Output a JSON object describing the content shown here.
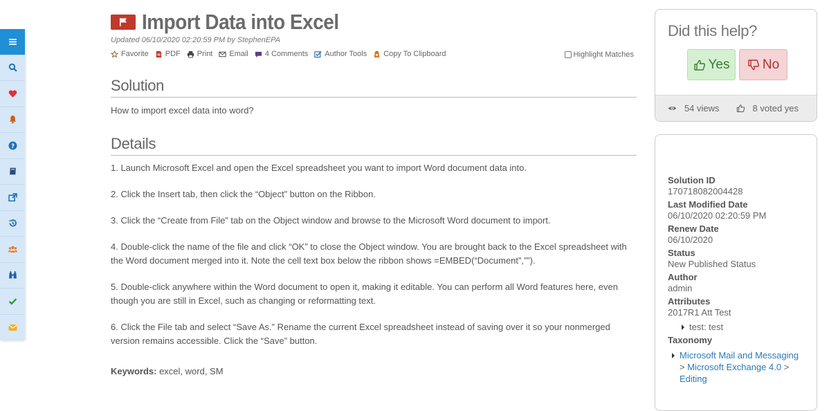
{
  "sidebar": {
    "items": [
      {
        "icon": "menu-icon",
        "color": "#ffffff"
      },
      {
        "icon": "search-icon",
        "color": "#1f6fb8"
      },
      {
        "icon": "heart-icon",
        "color": "#e0303b"
      },
      {
        "icon": "bell-icon",
        "color": "#d05a1a"
      },
      {
        "icon": "question-icon",
        "color": "#1f6fb8"
      },
      {
        "icon": "book-icon",
        "color": "#2b4a7a"
      },
      {
        "icon": "external-link-icon",
        "color": "#1f6fb8"
      },
      {
        "icon": "history-icon",
        "color": "#1f6fb8"
      },
      {
        "icon": "users-icon",
        "color": "#e8771c"
      },
      {
        "icon": "binoculars-icon",
        "color": "#1f5fa8"
      },
      {
        "icon": "check-icon",
        "color": "#2e9a3a"
      },
      {
        "icon": "envelope-icon",
        "color": "#f0b020"
      }
    ]
  },
  "article": {
    "title": "Import Data into Excel",
    "updated": "Updated 06/10/2020 02:20:59 PM by StephenEPA",
    "actions": {
      "favorite": "Favorite",
      "pdf": "PDF",
      "print": "Print",
      "email": "Email",
      "comments": "4 Comments",
      "author_tools": "Author Tools",
      "copy": "Copy To Clipboard"
    },
    "highlight_label": "Highlight Matches",
    "solution_heading": "Solution",
    "solution_text": "How to import excel data into word?",
    "details_heading": "Details",
    "steps": [
      "1. Launch Microsoft Excel and open the Excel spreadsheet you want to import Word document data into.",
      "2. Click the Insert tab, then click the “Object” button on the Ribbon.",
      "3. Click the “Create from File” tab on the Object window and browse to the Microsoft Word document to import.",
      "4. Double-click the name of the file and click “OK” to close the Object window. You are brought back to the Excel spreadsheet with the Word document merged into it. Note the cell text box below the ribbon shows =EMBED(“Document”,””).",
      "5. Double-click anywhere within the Word document to open it, making it editable. You can perform all Word features here, even though you are still in Excel, such as changing or reformatting text.",
      "6. Click the File tab and select “Save As.” Rename the current Excel spreadsheet instead of saving over it so your nonmerged version remains accessible. Click the “Save” button."
    ],
    "keywords_label": "Keywords:",
    "keywords_value": " excel, word, SM"
  },
  "help_panel": {
    "title": "Did this help?",
    "yes": "Yes",
    "no": "No",
    "views": "54 views",
    "voted": "8 voted yes"
  },
  "meta": {
    "solution_id_label": "Solution ID",
    "solution_id": "170718082004428",
    "last_modified_label": "Last Modified Date",
    "last_modified": "06/10/2020 02:20:59 PM",
    "renew_label": "Renew Date",
    "renew": "06/10/2020",
    "status_label": "Status",
    "status": "New Published Status",
    "author_label": "Author",
    "author": "admin",
    "attributes_label": "Attributes",
    "attributes": "2017R1 Att Test",
    "attribute_sub": "test: test",
    "taxonomy_label": "Taxonomy",
    "taxonomy_1": "Microsoft Mail and Messaging",
    "taxonomy_sep": " > ",
    "taxonomy_2": "Microsoft Exchange 4.0",
    "taxonomy_3": "Editing"
  }
}
